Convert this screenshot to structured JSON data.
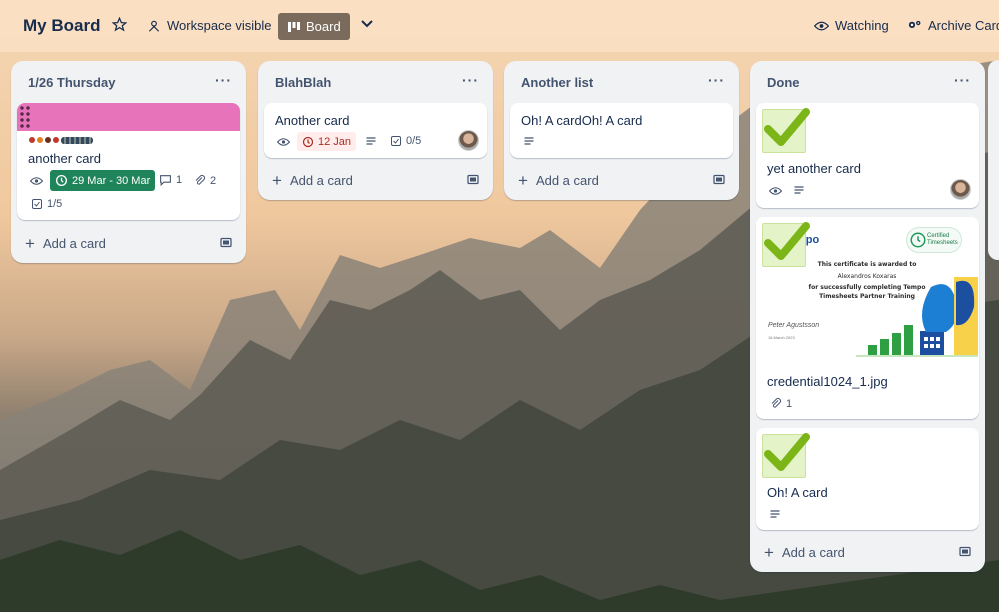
{
  "header": {
    "board_title": "My Board",
    "visibility_label": "Workspace visible",
    "view_label": "Board",
    "watching_label": "Watching",
    "archive_label": "Archive Cards"
  },
  "colors": {
    "label_pink": "#e774bb",
    "due_green": "#1f845a",
    "due_red_bg": "#ffeceb",
    "due_red_text": "#ae2e24",
    "board_button": "#7b6b5c"
  },
  "lists": [
    {
      "title": "1/26 Thursday",
      "add_card_label": "Add a card",
      "cards": [
        {
          "title": "another card",
          "cover_color": "#e774bb",
          "due": "29 Mar - 30 Mar",
          "comments": "1",
          "attachments": "2",
          "checklist": "1/5"
        }
      ]
    },
    {
      "title": "BlahBlah",
      "add_card_label": "Add a card",
      "cards": [
        {
          "title": "Another card",
          "due": "12 Jan",
          "checklist": "0/5"
        }
      ]
    },
    {
      "title": "Another list",
      "add_card_label": "Add a card",
      "cards": [
        {
          "title": "Oh! A cardOh! A card"
        }
      ]
    },
    {
      "title": "Done",
      "add_card_label": "Add a card",
      "cards": [
        {
          "title": "yet another card"
        },
        {
          "title": "credential1024_1.jpg",
          "attachments": "1",
          "certificate": {
            "logo": "mpo",
            "badge": "Certified Timesheets",
            "line1": "This certificate is awarded to",
            "line2": "Alexandros Koxaras",
            "line3": "for successfully completing Tempo",
            "line4": "Timesheets Partner Training",
            "signature": "Peter Agustsson",
            "date": "16 March 2023"
          }
        },
        {
          "title": "Oh! A card"
        }
      ]
    }
  ]
}
